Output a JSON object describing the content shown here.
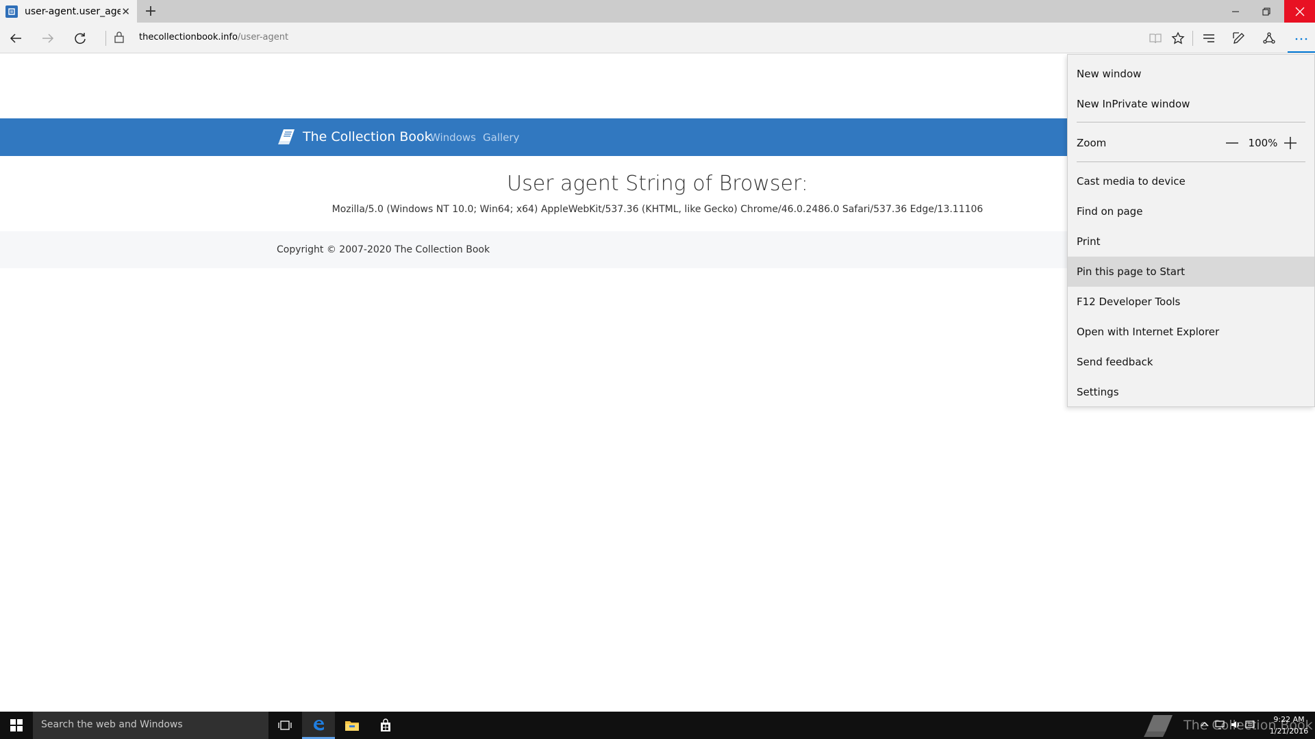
{
  "browser": {
    "tab_title": "user-agent.user_agent - ",
    "url_host": "thecollectionbook.info",
    "url_path": "/user-agent",
    "tab_close_glyph": "✕",
    "new_tab_glyph": "+"
  },
  "site": {
    "brand": "The Collection Book",
    "nav": [
      "Windows",
      "Gallery"
    ],
    "heading": "User agent String of Browser:",
    "user_agent": "Mozilla/5.0 (Windows NT 10.0; Win64; x64) AppleWebKit/537.36 (KHTML, like Gecko) Chrome/46.0.2486.0 Safari/537.36 Edge/13.11106",
    "copyright": "Copyright © 2007-2020 The Collection Book",
    "header_color": "#3178c0"
  },
  "menu": {
    "new_window": "New window",
    "new_inprivate": "New InPrivate window",
    "zoom_label": "Zoom",
    "zoom_value": "100%",
    "cast": "Cast media to device",
    "find": "Find on page",
    "print": "Print",
    "pin": "Pin this page to Start",
    "devtools": "F12 Developer Tools",
    "open_ie": "Open with Internet Explorer",
    "feedback": "Send feedback",
    "settings": "Settings",
    "highlighted_item": "Pin this page to Start"
  },
  "taskbar": {
    "search_placeholder": "Search the web and Windows",
    "watermark": "The Collection Book",
    "time": "9:22 AM",
    "date": "1/21/2016"
  },
  "colors": {
    "accent": "#0078d7",
    "close_button": "#e81123"
  }
}
